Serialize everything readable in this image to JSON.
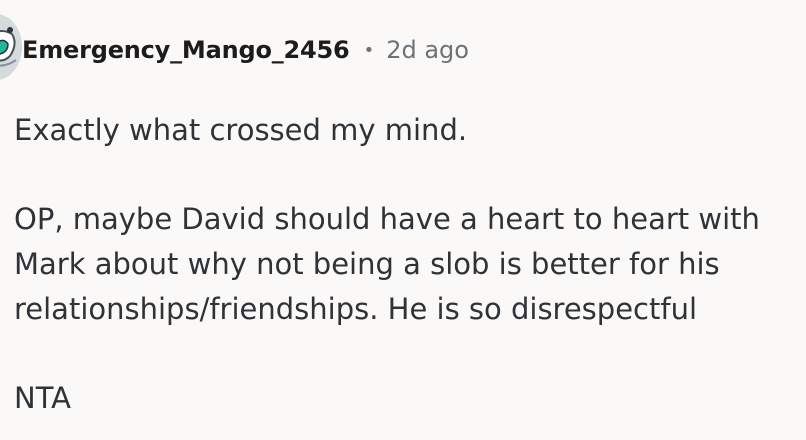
{
  "comment": {
    "author": "Emergency_Mango_2456",
    "separator": "•",
    "time": "2d ago",
    "paragraphs": [
      "Exactly what crossed my mind.",
      "OP, maybe David should have a heart to heart with Mark about why not being a slob is better for his relationships/friendships. He is so disrespectful",
      "NTA"
    ],
    "avatar_icon": "user-avatar-icon"
  },
  "colors": {
    "background": "#fbf9f8",
    "text": "#2e3338",
    "muted": "#6b7378",
    "avatar_accent": "#1fb89a"
  }
}
